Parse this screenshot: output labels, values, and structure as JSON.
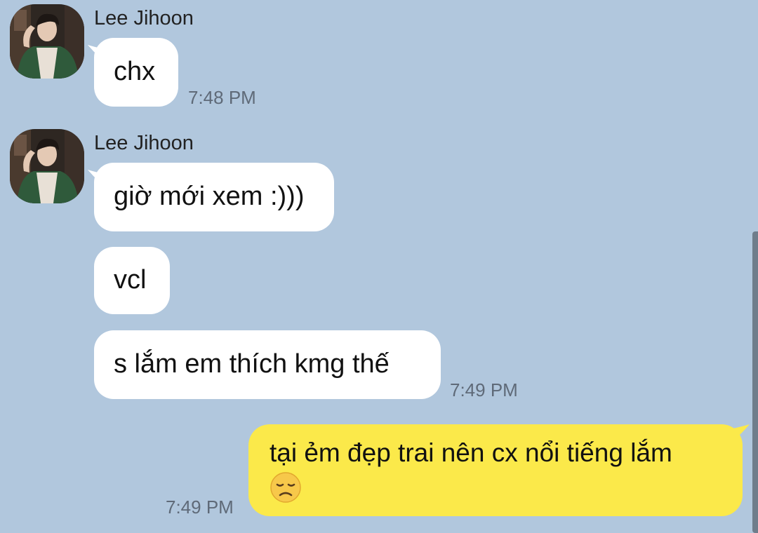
{
  "colors": {
    "background": "#b1c7dd",
    "incoming_bubble": "#ffffff",
    "outgoing_bubble": "#fbe94a",
    "timestamp": "#5f6a78"
  },
  "messages": [
    {
      "sender": "Lee Jihoon",
      "direction": "incoming",
      "text": "chx",
      "time": "7:48 PM"
    },
    {
      "sender": "Lee Jihoon",
      "direction": "incoming",
      "text": "giờ mới xem :)))"
    },
    {
      "direction": "incoming",
      "text": "vcl"
    },
    {
      "direction": "incoming",
      "text": "s lắm em thích kmg thế",
      "time": "7:49 PM"
    },
    {
      "direction": "outgoing",
      "text": "tại ẻm đẹp trai nên cx nổi tiếng lắm",
      "emoji": "disappointed-face",
      "time": "7:49 PM"
    }
  ]
}
